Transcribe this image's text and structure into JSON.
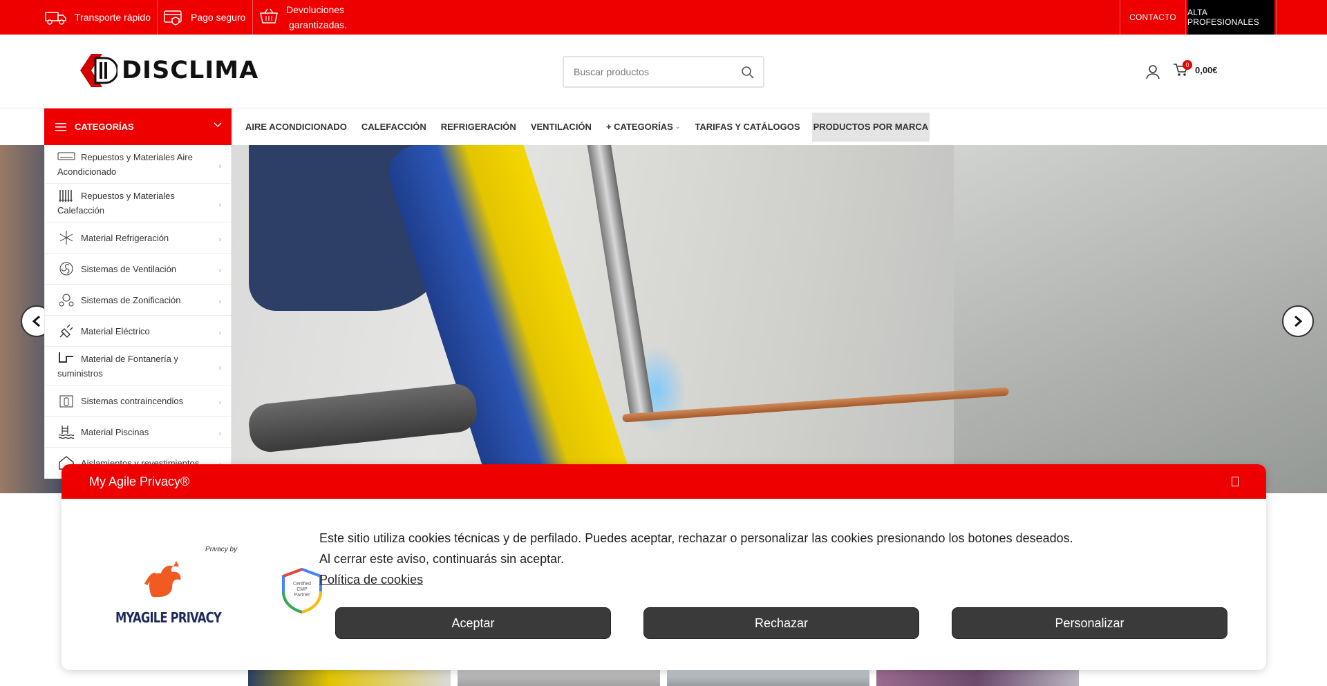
{
  "topbar": {
    "perks": [
      "Transporte rápido",
      "Pago seguro",
      "Devoluciones",
      "garantizadas."
    ],
    "links": {
      "contacto": "CONTACTO",
      "alta": "ALTA PROFESIONALES"
    },
    "accent": "#ee0000"
  },
  "header": {
    "logo_text": "DISCLIMA",
    "search_placeholder": "Buscar productos",
    "cart_count": "0",
    "cart_total": "0,00€"
  },
  "nav": {
    "categories_label": "CATEGORÍAS",
    "items": [
      "AIRE ACONDICIONADO",
      "CALEFACCIÓN",
      "REFRIGERACIÓN",
      "VENTILACIÓN",
      "+ CATEGORÍAS",
      "TARIFAS Y CATÁLOGOS",
      "PRODUCTOS POR MARCA"
    ]
  },
  "categories": [
    {
      "label": "Repuestos y Materiales Aire Acondicionado",
      "icon": "air-conditioner-icon"
    },
    {
      "label": "Repuestos y Materiales Calefacción",
      "icon": "radiator-icon"
    },
    {
      "label": "Material Refrigeración",
      "icon": "snowflake-icon"
    },
    {
      "label": "Sistemas de Ventilación",
      "icon": "fan-icon"
    },
    {
      "label": "Sistemas de Zonificación",
      "icon": "zoning-icon"
    },
    {
      "label": "Material Eléctrico",
      "icon": "plug-icon"
    },
    {
      "label": "Material de Fontanería y suministros",
      "icon": "pipe-icon"
    },
    {
      "label": "Sistemas contraincendios",
      "icon": "fire-extinguisher-icon"
    },
    {
      "label": "Material Piscinas",
      "icon": "pool-icon"
    },
    {
      "label": "Aislamientos y revestimientos",
      "icon": "insulation-icon"
    }
  ],
  "cookie": {
    "title": "My Agile Privacy®",
    "privacy_by": "Privacy by",
    "brand": "MYAGILE PRIVACY",
    "badge": [
      "Certified",
      "CMP",
      "Partner"
    ],
    "text_line1": "Este sitio utiliza cookies técnicas y de perfilado. Puedes aceptar, rechazar o personalizar las cookies presionando los botones deseados.",
    "text_line2": "Al cerrar este aviso, continuarás sin aceptar.",
    "policy_link": "Política de cookies",
    "buttons": {
      "accept": "Aceptar",
      "reject": "Rechazar",
      "customize": "Personalizar"
    }
  }
}
